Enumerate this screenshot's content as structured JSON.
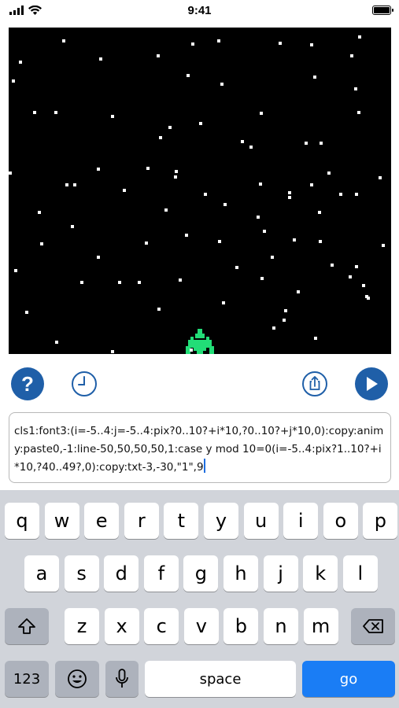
{
  "status": {
    "time": "9:41"
  },
  "toolbar": {
    "help_label": "?",
    "history_icon": "clock-icon",
    "share_icon": "share-icon",
    "run_icon": "play-icon"
  },
  "editor": {
    "code": "cls1:font3:(i=-5..4:j=-5..4:pix?0..10?+i*10,?0..10?+j*10,0):copy:anim y:paste0,-1:line-50,50,50,50,1:case y mod 10=0(i=-5..4:pix?1..10?+i*10,?40..49?,0):copy:txt-3,-30,\"1\",9"
  },
  "keyboard": {
    "row1": [
      "q",
      "w",
      "e",
      "r",
      "t",
      "y",
      "u",
      "i",
      "o",
      "p"
    ],
    "row2": [
      "a",
      "s",
      "d",
      "f",
      "g",
      "h",
      "j",
      "k",
      "l"
    ],
    "row3": [
      "z",
      "x",
      "c",
      "v",
      "b",
      "n",
      "m"
    ],
    "numbers_label": "123",
    "space_label": "space",
    "go_label": "go"
  },
  "colors": {
    "accent": "#1f5fa8",
    "go_key": "#1a7df5",
    "ship": "#22dd77"
  }
}
